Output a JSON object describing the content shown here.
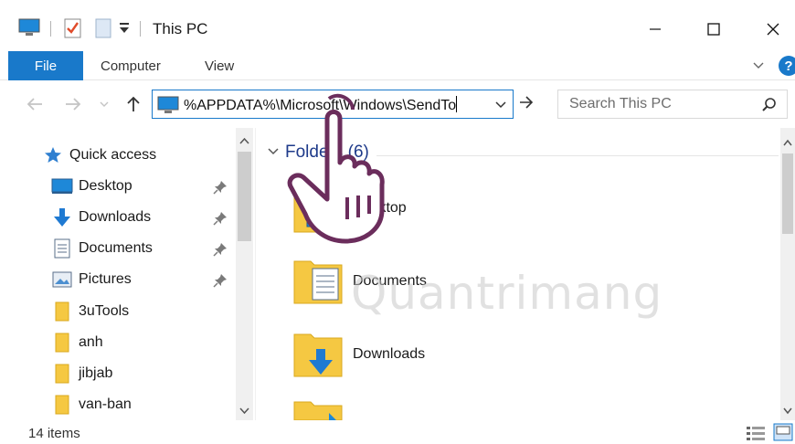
{
  "window": {
    "title": "This PC",
    "buttons": [
      "minimize",
      "maximize",
      "close"
    ]
  },
  "quick_access_toolbar": {
    "icons": [
      "computer-icon",
      "properties-icon",
      "new-folder-icon",
      "customize-dropdown-icon"
    ]
  },
  "ribbon": {
    "file_label": "File",
    "tabs": [
      {
        "label": "Computer"
      },
      {
        "label": "View"
      }
    ],
    "help_label": "?"
  },
  "address_bar": {
    "value": "%APPDATA%\\Microsoft\\Windows\\SendTo"
  },
  "search": {
    "placeholder": "Search This PC"
  },
  "nav_pane": {
    "quick_access_label": "Quick access",
    "items": [
      {
        "label": "Desktop",
        "icon": "desktop-icon",
        "pinned": true
      },
      {
        "label": "Downloads",
        "icon": "download-arrow-icon",
        "pinned": true
      },
      {
        "label": "Documents",
        "icon": "document-icon",
        "pinned": true
      },
      {
        "label": "Pictures",
        "icon": "pictures-icon",
        "pinned": true
      },
      {
        "label": "3uTools",
        "icon": "folder-icon",
        "pinned": false
      },
      {
        "label": "anh",
        "icon": "folder-icon",
        "pinned": false
      },
      {
        "label": "jibjab",
        "icon": "folder-icon",
        "pinned": false
      },
      {
        "label": "van-ban",
        "icon": "folder-icon",
        "pinned": false
      }
    ]
  },
  "content": {
    "group_label": "Folders (6)",
    "folders": [
      {
        "label": "Desktop"
      },
      {
        "label": "Documents"
      },
      {
        "label": "Downloads"
      }
    ]
  },
  "status_bar": {
    "item_count": "14 items"
  },
  "colors": {
    "accent": "#1979ca",
    "folder_yellow": "#f5c842",
    "hand_outline": "#6b2d5c"
  }
}
